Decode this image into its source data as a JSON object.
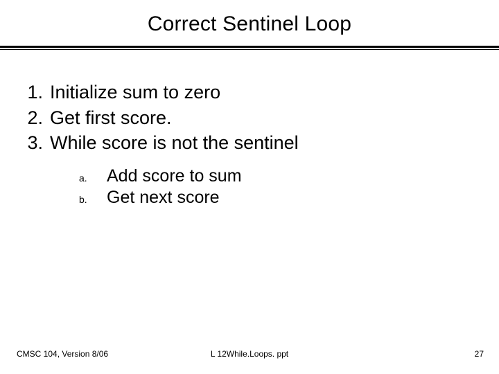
{
  "title": "Correct Sentinel Loop",
  "steps": {
    "s1": {
      "num": "1.",
      "text": "Initialize sum to zero"
    },
    "s2": {
      "num": "2.",
      "text": "Get first score."
    },
    "s3": {
      "num": "3.",
      "text": "While score is not the sentinel"
    }
  },
  "substeps": {
    "a": {
      "lbl": "a.",
      "text": "Add score to sum"
    },
    "b": {
      "lbl": "b.",
      "text": "Get next score"
    }
  },
  "footer": {
    "left": "CMSC 104, Version 8/06",
    "center": "L 12While.Loops. ppt",
    "right": "27"
  }
}
